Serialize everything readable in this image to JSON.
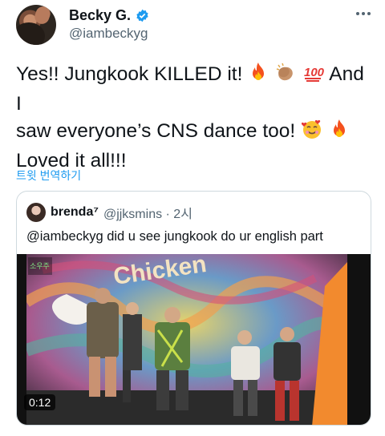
{
  "tweet": {
    "author": {
      "display_name": "Becky G.",
      "handle": "@iambeckyg",
      "verified": true
    },
    "text_line1": "Yes!! Jungkook KILLED it!",
    "text_line1b": "And I",
    "text_line2": "saw everyone’s CNS dance too!",
    "text_line3": "Loved it all!!!",
    "translate_label": "트윗 번역하기",
    "emojis": [
      "fire-emoji",
      "clapping-hands-emoji",
      "hundred-points-emoji",
      "smiling-face-with-hearts-emoji",
      "fire-emoji"
    ]
  },
  "quote": {
    "author_name": "brenda⁷",
    "handle_time": "@jjksmins · 2시",
    "text": "@iambeckyg did u see jungkook do ur english part",
    "video": {
      "timestamp": "0:12",
      "channel_logo_text": "소우주",
      "banner_text": "Chicken"
    }
  },
  "colors": {
    "accent": "#1d9bf0",
    "muted": "#536471",
    "border": "#cfd9de"
  }
}
